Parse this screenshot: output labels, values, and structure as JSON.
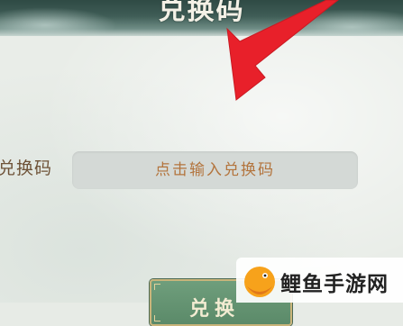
{
  "header": {
    "title": "兑换码"
  },
  "form": {
    "label": "兑换码",
    "input_placeholder": "点击输入兑换码",
    "input_value": ""
  },
  "redeem_button": {
    "label": "兑换"
  },
  "annotation": {
    "arrow_color": "#e8202a",
    "arrow_target": "code-input"
  },
  "watermark": {
    "text": "鲤鱼手游网",
    "logo_color": "#f7a21b"
  },
  "colors": {
    "header_bg": "#3f5d56",
    "panel_bg": "#e9ede8",
    "label_text": "#6e5237",
    "placeholder_text": "#b3743d",
    "button_green": "#5b8a69"
  }
}
